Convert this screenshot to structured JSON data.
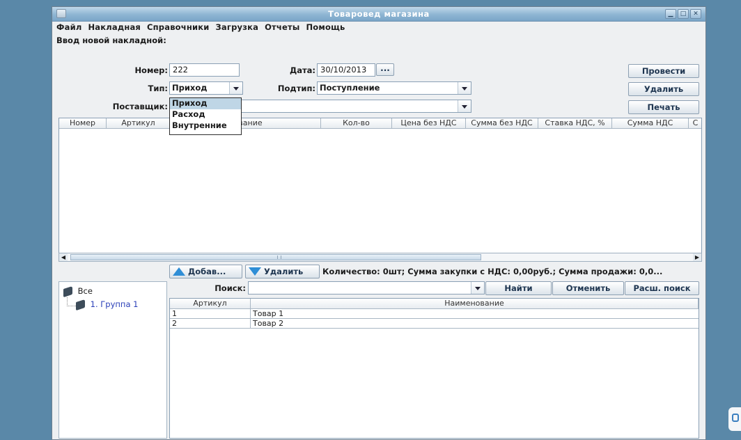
{
  "window": {
    "title": "Товаровед магазина",
    "controls": [
      "minimize",
      "maximize",
      "close"
    ]
  },
  "menu": [
    "Файл",
    "Накладная",
    "Справочники",
    "Загрузка",
    "Отчеты",
    "Помощь"
  ],
  "form": {
    "heading": "Ввод новой накладной:",
    "number_label": "Номер:",
    "number_value": "222",
    "date_label": "Дата:",
    "date_value": "30/10/2013",
    "date_button": "...",
    "type_label": "Тип:",
    "type_value": "Приход",
    "subtype_label": "Подтип:",
    "subtype_value": "Поступление",
    "supplier_label": "Поставщик:",
    "supplier_value": ""
  },
  "actions": {
    "post": "Провести",
    "delete": "Удалить",
    "print": "Печать"
  },
  "type_dropdown": {
    "options": [
      "Приход",
      "Расход",
      "Внутренние"
    ],
    "selected": "Приход"
  },
  "invoice_table": {
    "columns": [
      "Номер",
      "Артикул",
      "нование",
      "Кол-во",
      "Цена без НДС",
      "Сумма без НДС",
      "Ставка НДС, %",
      "Сумма НДС",
      "С"
    ],
    "rows": []
  },
  "item_actions": {
    "add": "Добав...",
    "remove": "Удалить",
    "summary": "Количество: 0шт; Сумма закупки с НДС: 0,00руб.; Сумма продажи: 0,0..."
  },
  "tree": {
    "root": "Все",
    "children": [
      "1. Группа 1"
    ]
  },
  "search": {
    "label": "Поиск:",
    "value": "",
    "find": "Найти",
    "cancel": "Отменить",
    "advanced": "Расш. поиск"
  },
  "products_table": {
    "columns": [
      "Артикул",
      "Наименование"
    ],
    "rows": [
      {
        "article": "1",
        "name": "Товар 1"
      },
      {
        "article": "2",
        "name": "Товар 2"
      }
    ]
  },
  "colors": {
    "desktop": "#5a88a8",
    "titlebar": "#8eb5d3",
    "selection": "#bfd6e6",
    "accent": "#2f8ed6"
  }
}
